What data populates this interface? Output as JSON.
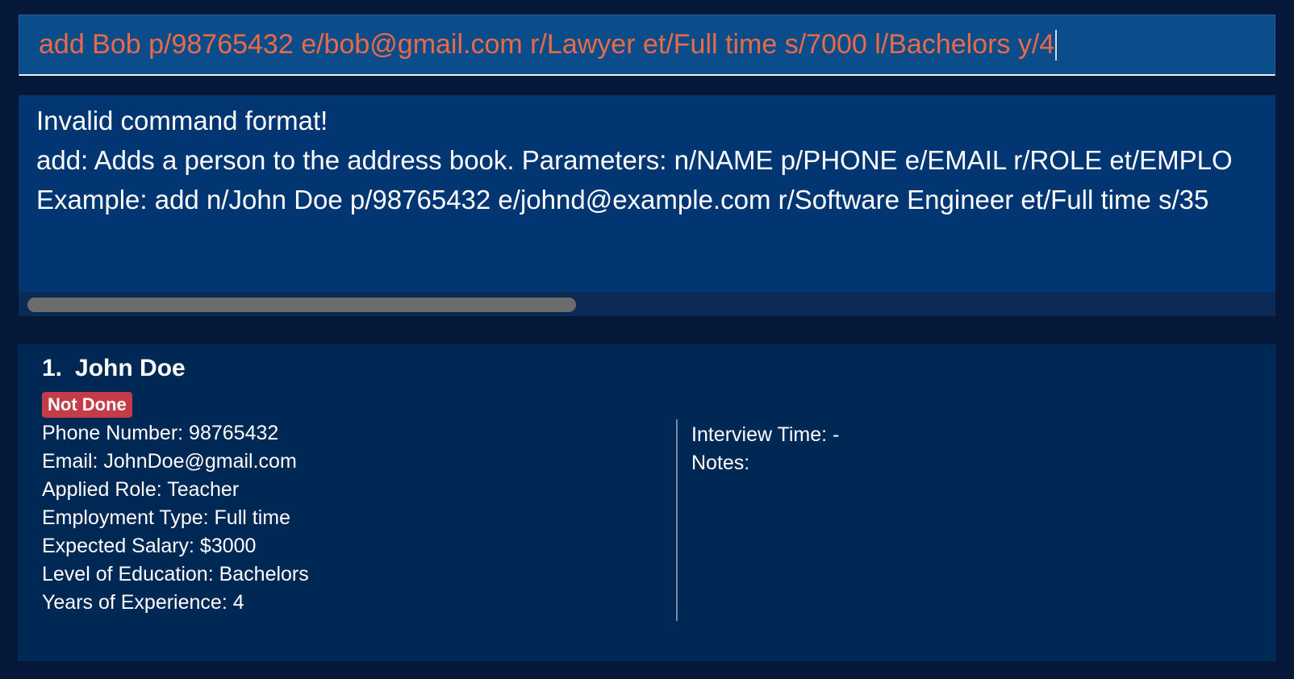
{
  "command_box": {
    "value": "add Bob p/98765432 e/bob@gmail.com r/Lawyer et/Full time s/7000 l/Bachelors y/4"
  },
  "result_display": {
    "lines": [
      "Invalid command format!",
      "add: Adds a person to the address book. Parameters: n/NAME p/PHONE e/EMAIL r/ROLE et/EMPLO",
      "Example: add n/John Doe p/98765432 e/johnd@example.com r/Software Engineer et/Full time s/35"
    ]
  },
  "person_list": [
    {
      "index": "1.",
      "name": "John Doe",
      "status": "Not Done",
      "phone": "Phone Number: 98765432",
      "email": "Email: JohnDoe@gmail.com",
      "role": "Applied Role: Teacher",
      "employment_type": "Employment Type: Full time",
      "salary": "Expected Salary: $3000",
      "education": "Level of Education: Bachelors",
      "experience": "Years of Experience: 4",
      "interview_time": "Interview Time: -",
      "notes": "Notes:"
    }
  ],
  "colors": {
    "background": "#06183a",
    "command_box": "#0b4d8a",
    "command_text": "#ea6a47",
    "result_box": "#023672",
    "card": "#002855",
    "status_not_done": "#c43c48"
  }
}
